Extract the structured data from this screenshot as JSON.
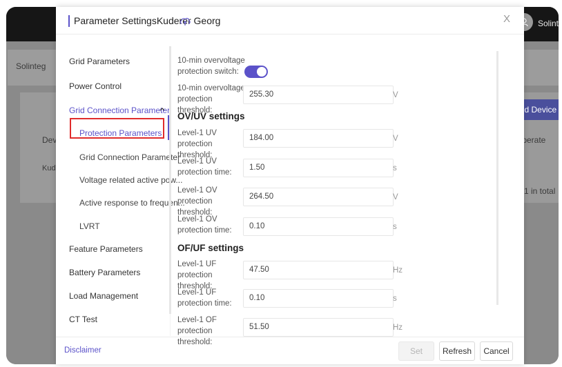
{
  "background": {
    "user_name": "Solinteg",
    "filter_value": "Solinteg",
    "add_device_label": "Add Device",
    "col_device": "Device",
    "col_operate": "Operate",
    "row_device": "Kuderer",
    "total_text": "1 in total",
    "colors": {
      "topbar": "#161616",
      "overlay": "#8a8a8a",
      "accent": "#4a4f9c"
    }
  },
  "modal": {
    "title": "Parameter SettingsKuderer Georg",
    "close_label": "X",
    "accent_color": "#5b52c9",
    "sidebar": {
      "items": [
        {
          "label": "Grid Parameters"
        },
        {
          "label": "Power Control"
        },
        {
          "label": "Grid Connection Parameter",
          "expanded": true
        },
        {
          "label": "Protection Parameters",
          "selected": true
        },
        {
          "label": "Grid Connection Parameter"
        },
        {
          "label": "Voltage related active pow..."
        },
        {
          "label": "Active response to frequen..."
        },
        {
          "label": "LVRT"
        },
        {
          "label": "Feature Parameters"
        },
        {
          "label": "Battery Parameters"
        },
        {
          "label": "Load Management"
        },
        {
          "label": "CT Test"
        }
      ]
    },
    "form": {
      "switch": {
        "label": "10-min overvoltage protection switch:",
        "on": true
      },
      "threshold": {
        "label": "10-min overvoltage protection threshold:",
        "value": "255.30",
        "unit": "V"
      },
      "ov_uv_title": "OV/UV settings",
      "ov_uv": [
        {
          "label": "Level-1 UV protection threshold:",
          "value": "184.00",
          "unit": "V"
        },
        {
          "label": "Level-1 UV protection time:",
          "value": "1.50",
          "unit": "s"
        },
        {
          "label": "Level-1 OV protection threshold:",
          "value": "264.50",
          "unit": "V"
        },
        {
          "label": "Level-1 OV protection time:",
          "value": "0.10",
          "unit": "s"
        }
      ],
      "of_uf_title": "OF/UF settings",
      "of_uf": [
        {
          "label": "Level-1 UF protection threshold:",
          "value": "47.50",
          "unit": "Hz"
        },
        {
          "label": "Level-1 UF protection time:",
          "value": "0.10",
          "unit": "s"
        },
        {
          "label": "Level-1 OF protection threshold:",
          "value": "51.50",
          "unit": "Hz"
        }
      ]
    },
    "footer": {
      "disclaimer": "Disclaimer",
      "set_label": "Set",
      "refresh_label": "Refresh",
      "cancel_label": "Cancel"
    }
  }
}
